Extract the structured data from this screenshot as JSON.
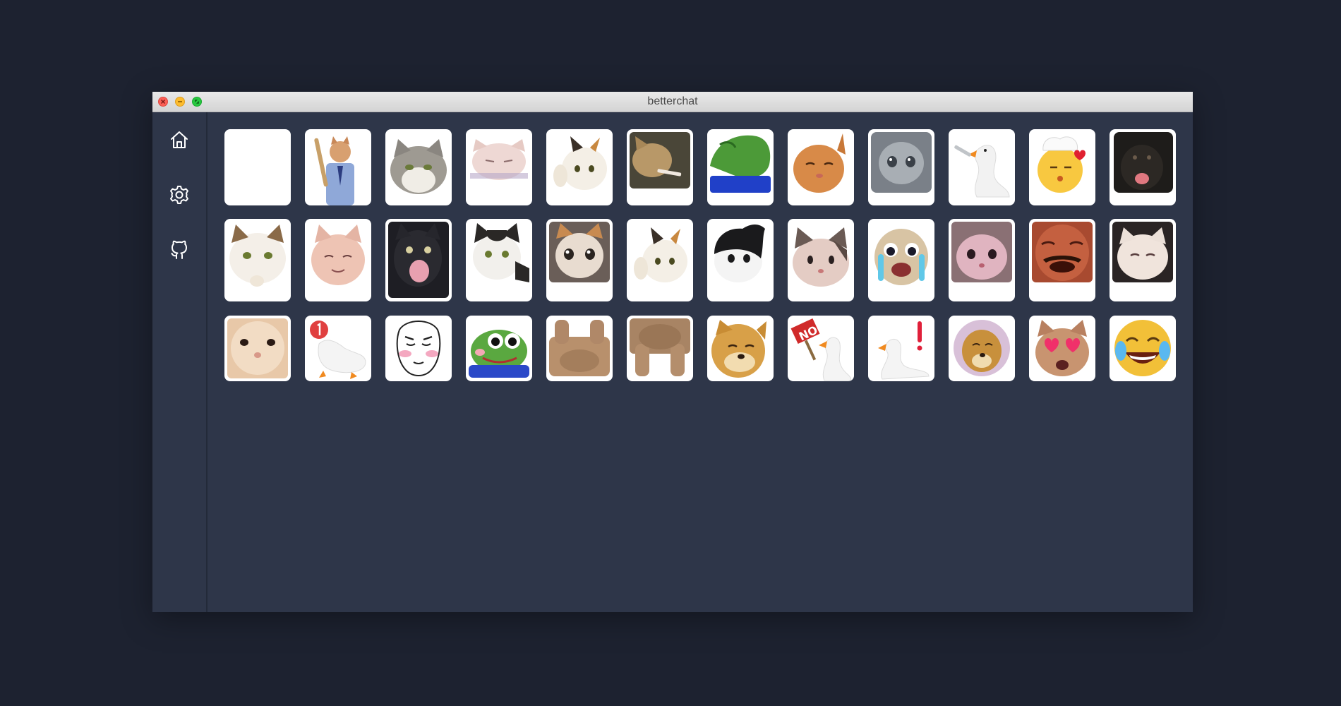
{
  "window": {
    "title": "betterchat"
  },
  "sidebar": {
    "items": [
      {
        "name": "home",
        "icon": "home-icon"
      },
      {
        "name": "settings",
        "icon": "gear-icon"
      },
      {
        "name": "github",
        "icon": "github-icon"
      }
    ]
  },
  "colors": {
    "background": "#1d2230",
    "panel": "#2e3649",
    "tile": "#ffffff",
    "close": "#fc5f56",
    "minimize": "#fdbc2e",
    "maximize": "#28c840"
  },
  "stickers": [
    [
      "blank",
      "cat-in-suit-with-bat",
      "grey-cat-meme",
      "smudge-table-cat",
      "calico-cat-thumbs-up",
      "cat-smoking",
      "pepe-frog-lying",
      "orange-cat-squint",
      "crying-grey-cat",
      "goose-with-knife",
      "chef-kiss-emoji",
      "black-dog-smile"
    ],
    [
      "white-cat-thinking",
      "pink-cat-smile",
      "black-cat-screaming",
      "tuxedo-cat",
      "crying-cat",
      "calico-cat-thumbs-up-2",
      "tuxedo-cat-looking-up",
      "beluga-cat",
      "cat-crying-tears",
      "pink-beluga-cat",
      "man-laughing",
      "white-cat-dark-bg"
    ],
    [
      "cat-close-up",
      "goose-notification",
      "blushing-face",
      "pepe-frog-smile",
      "loaf-cat-paws",
      "cat-paws-up",
      "cheems-doge",
      "goose-no-sign",
      "goose-exclamation",
      "doge-circle",
      "heart-eyes-cat",
      "laughing-crying-emoji"
    ]
  ]
}
